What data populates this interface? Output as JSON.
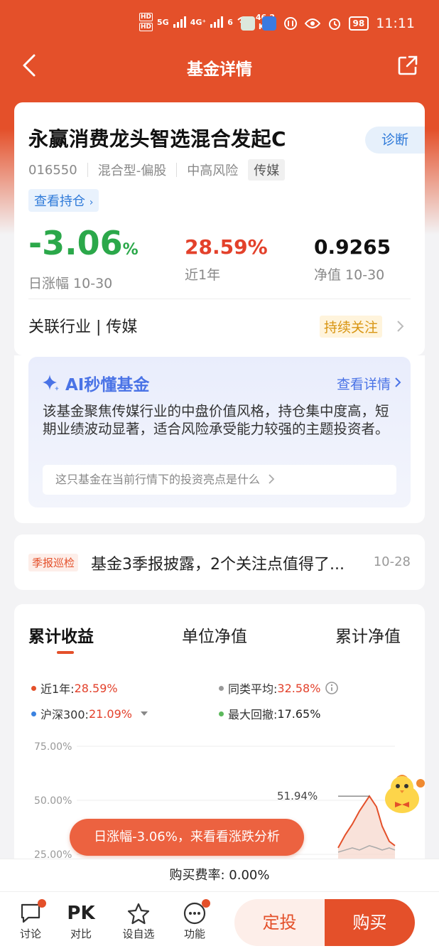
{
  "status": {
    "left_labels": [
      "HD",
      "HD",
      "5G",
      "4G⁺",
      "6"
    ],
    "speed_value": "46.2",
    "speed_unit": "K/s",
    "battery": "98",
    "time": "11:11"
  },
  "nav": {
    "title": "基金详情"
  },
  "fund": {
    "name": "永赢消费龙头智选混合发起C",
    "diagnose": "诊断",
    "code": "016550",
    "type": "混合型-偏股",
    "risk": "中高风险",
    "tag": "传媒",
    "holdings_link": "查看持仓",
    "daily_change": "-3.06",
    "daily_change_unit": "%",
    "daily_label": "日涨幅 10-30",
    "year_return": "28.59%",
    "year_label": "近1年",
    "nav_value": "0.9265",
    "nav_label": "净值 10-30",
    "industry": "关联行业 | 传媒",
    "follow": "持续关注"
  },
  "ai": {
    "title": "AI秒懂基金",
    "detail": "查看详情",
    "text": "该基金聚焦传媒行业的中盘价值风格，持仓集中度高，短期业绩波动显著，适合风险承受能力较强的主题投资者。",
    "question": "这只基金在当前行情下的投资亮点是什么"
  },
  "news": {
    "badge": "季报巡检",
    "title": "基金3季报披露，2个关注点值得了...",
    "date": "10-28"
  },
  "chart_section": {
    "tabs": [
      "累计收益",
      "单位净值",
      "累计净值"
    ],
    "legend": [
      {
        "label": "近1年:",
        "value": "28.59%",
        "color": "#e4502a"
      },
      {
        "label": "同类平均:",
        "value": "32.58%",
        "color": "#999999"
      },
      {
        "label": "沪深300:",
        "value": "21.09%",
        "color": "#3b82e0"
      },
      {
        "label": "最大回撤:",
        "value": "17.65%",
        "color": "#5cb85c"
      }
    ]
  },
  "chart_data": {
    "type": "area",
    "y_ticks": [
      "75.00%",
      "50.00%",
      "25.00%"
    ],
    "ylim": [
      25,
      75
    ],
    "peak_label": "51.94%",
    "series": [
      {
        "name": "近1年",
        "values": [
          28,
          34,
          39,
          45,
          51.94,
          47,
          38,
          31,
          29
        ]
      },
      {
        "name": "同类平均",
        "values": [
          26,
          27,
          28,
          27,
          29,
          28,
          27,
          28,
          27
        ]
      }
    ]
  },
  "promo": {
    "pill": "日涨幅-3.06%，来看看涨跌分析"
  },
  "fee": {
    "text": "购买费率: 0.00%"
  },
  "bottom": {
    "discuss": "讨论",
    "pk_glyph": "PK",
    "compare": "对比",
    "watch": "设自选",
    "func": "功能",
    "dingtou": "定投",
    "buy": "购买"
  },
  "colors": {
    "brand": "#e4502a",
    "up": "#e3412b",
    "down": "#2ba84a",
    "ai": "#4a73e6"
  }
}
